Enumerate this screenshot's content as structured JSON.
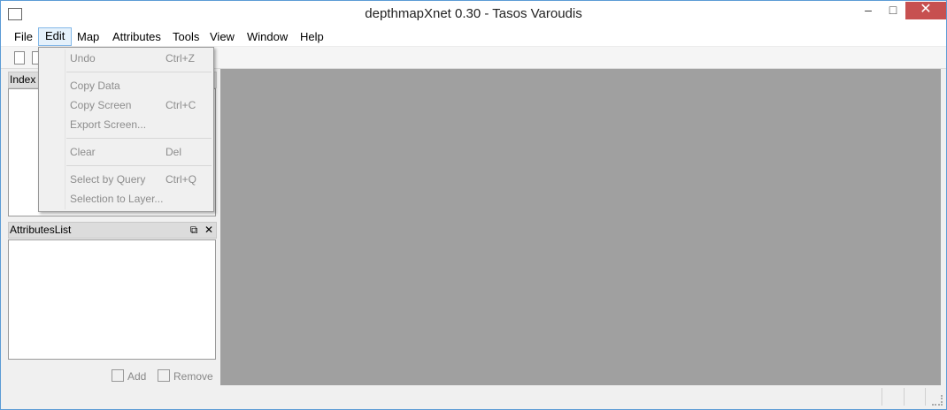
{
  "window": {
    "title": "depthmapXnet 0.30 - Tasos Varoudis"
  },
  "menubar": {
    "items": [
      "File",
      "Edit",
      "Map",
      "Attributes",
      "Tools",
      "View",
      "Window",
      "Help"
    ],
    "active": "Edit"
  },
  "edit_menu": {
    "items": [
      {
        "label": "Undo",
        "shortcut": "Ctrl+Z"
      },
      {
        "label": "Copy Data",
        "shortcut": ""
      },
      {
        "label": "Copy Screen",
        "shortcut": "Ctrl+C"
      },
      {
        "label": "Export Screen...",
        "shortcut": ""
      },
      {
        "label": "Clear",
        "shortcut": "Del"
      },
      {
        "label": "Select by Query",
        "shortcut": "Ctrl+Q"
      },
      {
        "label": "Selection to Layer...",
        "shortcut": ""
      }
    ]
  },
  "index_panel": {
    "title": "Index"
  },
  "attributes_panel": {
    "title": "AttributesList",
    "add_label": "Add",
    "remove_label": "Remove"
  },
  "colors": {
    "canvas": "#a0a0a0",
    "close_button": "#c75050",
    "menu_active": "#e5f1fb"
  }
}
